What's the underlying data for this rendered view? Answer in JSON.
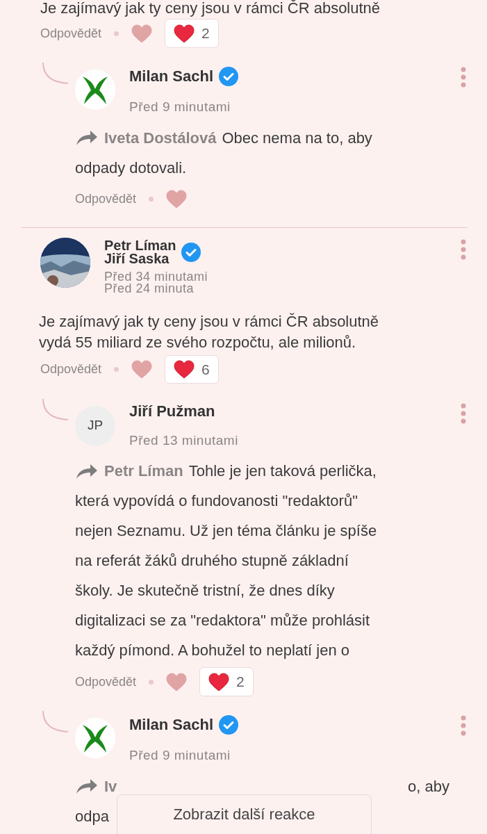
{
  "blocks": [
    {
      "kind": "fragment",
      "text": "Je zajímavý jak ty ceny jsou v rámci ČR absolutně"
    },
    {
      "kind": "actions",
      "reply_label": "Odpovědět",
      "liked": false,
      "reactions": "2"
    },
    {
      "kind": "reply",
      "avatar": {
        "kind": "x-mark"
      },
      "authors": [
        "Milan Sachl"
      ],
      "verified": true,
      "times": [
        "Před 9 minutami"
      ],
      "mention": "Iveta Dostálová",
      "lines": [
        "Obec nema na to, aby",
        "odpady dotovali."
      ],
      "covered": false
    },
    {
      "kind": "actions",
      "reply_label": "Odpovědět",
      "liked": false
    },
    {
      "kind": "comment",
      "authors": [
        "Petr Líman",
        "Jiří Saska"
      ],
      "verified": true,
      "times": [
        "Před 34 minutami",
        "Před 24 minuta"
      ],
      "lines": [
        "Je zajímavý jak ty ceny jsou v rámci ČR absolutně",
        "vydá 55 miliard ze svého rozpočtu, ale milionů."
      ]
    },
    {
      "kind": "actions",
      "reply_label": "Odpovědět",
      "liked": false,
      "reactions": "6"
    },
    {
      "kind": "reply",
      "avatar": {
        "kind": "initials",
        "initials": "JP"
      },
      "authors": [
        "Jiří Pužman"
      ],
      "verified": false,
      "times": [
        "Před 13 minutami"
      ],
      "mention": "Petr Líman",
      "lines": [
        "Tohle je jen taková perlička,",
        "která vypovídá o fundovanosti \"redaktorů\"",
        "nejen Seznamu. Už jen téma článku je spíše",
        "na referát žáků druhého stupně základní",
        "školy. Je skutečně tristní, že dnes díky",
        "digitalizaci se za \"redaktora\" může prohlásit",
        "každý pímond. A bohužel to neplatí jen o"
      ],
      "covered": false
    },
    {
      "kind": "actions",
      "reply_label": "Odpovědět",
      "liked": false,
      "reactions": "2"
    },
    {
      "kind": "reply",
      "avatar": {
        "kind": "x-mark"
      },
      "authors": [
        "Milan Sachl"
      ],
      "verified": true,
      "times": [
        "Před 9 minutami"
      ],
      "mention": "Iv",
      "lines": [
        "o, aby",
        "odpa"
      ],
      "covered": true
    }
  ],
  "more_button": "Zobrazit další reakce"
}
